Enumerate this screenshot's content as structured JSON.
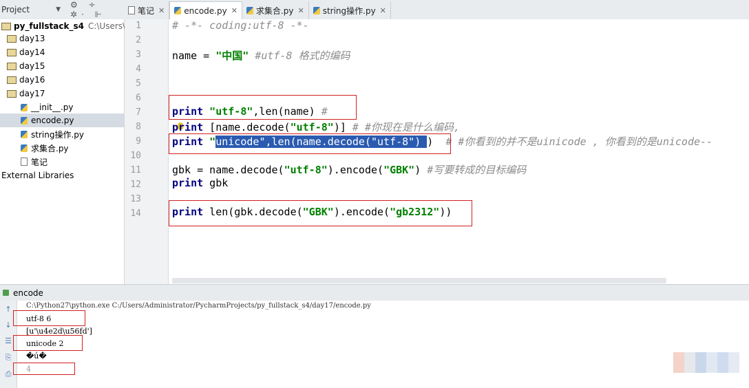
{
  "project_header": {
    "label": "Project",
    "dropdown": "▼",
    "toolbar_icons": "⚙ ÷ ✲· ⊩"
  },
  "tabs": [
    {
      "label": "笔记",
      "type": "note",
      "active": false
    },
    {
      "label": "encode.py",
      "type": "py",
      "active": true
    },
    {
      "label": "求集合.py",
      "type": "py",
      "active": false
    },
    {
      "label": "string操作.py",
      "type": "py",
      "active": false
    }
  ],
  "tree": {
    "root": {
      "name": "py_fullstack_s4",
      "path": "C:\\Users\\Admi"
    },
    "folders": [
      "day13",
      "day14",
      "day15",
      "day16",
      "day17"
    ],
    "files": [
      "__init__.py",
      "encode.py",
      "string操作.py",
      "求集合.py",
      "笔记"
    ],
    "external": "External Libraries"
  },
  "line_numbers": [
    "1",
    "2",
    "3",
    "4",
    "5",
    "6",
    "7",
    "8",
    "9",
    "10",
    "11",
    "12",
    "13",
    "14"
  ],
  "code": {
    "l1": "# -*- coding:utf-8 -*-",
    "l3_a": "name = ",
    "l3_str": "\"中国\"",
    "l3_cmt": " #utf-8 格式的编码",
    "l7_kw": "print",
    "l7_str": " \"utf-8\"",
    "l7_rest": ",len(name) ",
    "l7_cmt": "#",
    "l8_kw": "print",
    "l8_a": " [name.decode(",
    "l8_str": "\"utf-8\"",
    "l8_b": ")] ",
    "l8_cmt": "# #你现在是什么编码,",
    "l9_kw": "print",
    "l9_q1": " \"",
    "l9_sel1": "unicode",
    "l9_sel2": "\",len(name.decode(",
    "l9_sel3": "\"utf-8\"",
    "l9_sel4": ") ",
    "l9_b": ")  ",
    "l9_cmt": "# #你看到的并不是uinicode , 你看到的是unicode--",
    "l11_a": "gbk = name.decode(",
    "l11_str1": "\"utf-8\"",
    "l11_b": ").encode(",
    "l11_str2": "\"GBK\"",
    "l11_c": ") ",
    "l11_cmt": "#写要转成的目标编码",
    "l12_kw": "print",
    "l12_a": " gbk",
    "l14_kw": "print",
    "l14_a": " len(gbk.decode(",
    "l14_str1": "\"GBK\"",
    "l14_b": ").encode(",
    "l14_str2": "\"gb2312\"",
    "l14_c": "))"
  },
  "run": {
    "title": "encode",
    "lines": [
      "C:\\Python27\\python.exe C:/Users/Administrator/PycharmProjects/py_fullstack_s4/day17/encode.py",
      "utf-8 6",
      "[u'\\u4e2d\\u56fd']",
      "unicode 2",
      "�ú�",
      "4"
    ],
    "tool_icons": [
      "↑",
      "↓",
      "☰",
      "⎘",
      "⎙"
    ]
  },
  "colors": {
    "keyword": "#000080",
    "string": "#008000",
    "comment": "#8c8c8c",
    "selection": "#2a5bb0",
    "annotation_box": "#d02020"
  }
}
